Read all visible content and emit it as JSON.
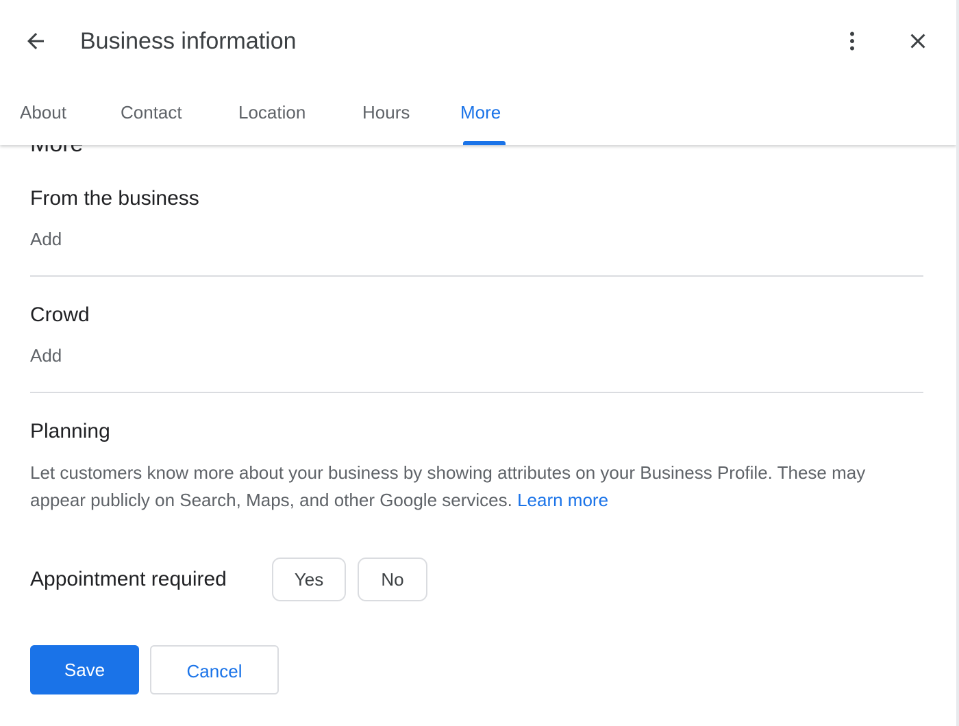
{
  "header": {
    "title": "Business information"
  },
  "tabs": [
    {
      "label": "About"
    },
    {
      "label": "Contact"
    },
    {
      "label": "Location"
    },
    {
      "label": "Hours"
    },
    {
      "label": "More",
      "active": true
    }
  ],
  "content": {
    "peek_heading": "More",
    "sections": [
      {
        "title": "From the business",
        "action": "Add"
      },
      {
        "title": "Crowd",
        "action": "Add"
      },
      {
        "title": "Planning"
      }
    ],
    "planning_description": "Let customers know more about your business by showing attributes on your Business Profile. These may appear publicly on Search, Maps, and other Google services.",
    "learn_more": "Learn more",
    "attribute": {
      "label": "Appointment required",
      "yes": "Yes",
      "no": "No"
    }
  },
  "actions": {
    "save": "Save",
    "cancel": "Cancel"
  },
  "colors": {
    "accent": "#1a73e8",
    "text_primary": "#202124",
    "text_secondary": "#5f6368",
    "divider": "#dadce0"
  },
  "icons": {
    "back": "arrow-back-icon",
    "more": "more-vert-icon",
    "close": "close-icon"
  }
}
